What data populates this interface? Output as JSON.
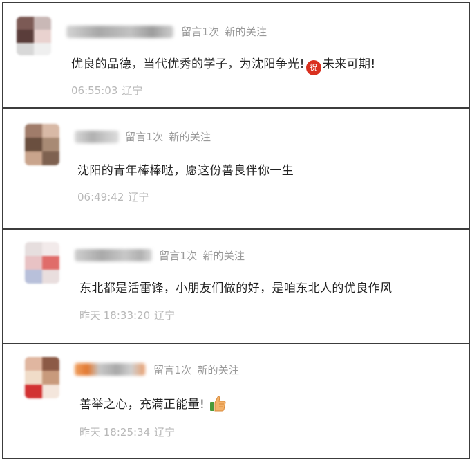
{
  "comments": [
    {
      "meta": {
        "message_count": "留言1次",
        "follow_status": "新的关注"
      },
      "text": "优良的品德，当代优秀的学子，为沈阳争光!",
      "emoji_label": "祝",
      "text_after": "未来可期!",
      "time": "06:55:03",
      "location": "辽宁"
    },
    {
      "meta": {
        "message_count": "留言1次",
        "follow_status": "新的关注"
      },
      "text": "沈阳的青年棒棒哒，愿这份善良伴你一生",
      "time": "06:49:42",
      "location": "辽宁"
    },
    {
      "meta": {
        "message_count": "留言1次",
        "follow_status": "新的关注"
      },
      "text": "东北都是活雷锋，小朋友们做的好，是咱东北人的优良作风",
      "time": "昨天 18:33:20",
      "location": "辽宁"
    },
    {
      "meta": {
        "message_count": "留言1次",
        "follow_status": "新的关注"
      },
      "text": "善举之心，充满正能量!",
      "time": "昨天 18:25:34",
      "location": "辽宁"
    }
  ],
  "icons": {
    "emoji_zhu": "celebrate-emoji-icon",
    "thumbs_up": "thumbs-up-icon"
  },
  "colors": {
    "meta_text": "#999999",
    "time_text": "#b8b8b8",
    "content_text": "#222222",
    "border": "#3c3c3c",
    "emoji_red": "#d9301f"
  }
}
